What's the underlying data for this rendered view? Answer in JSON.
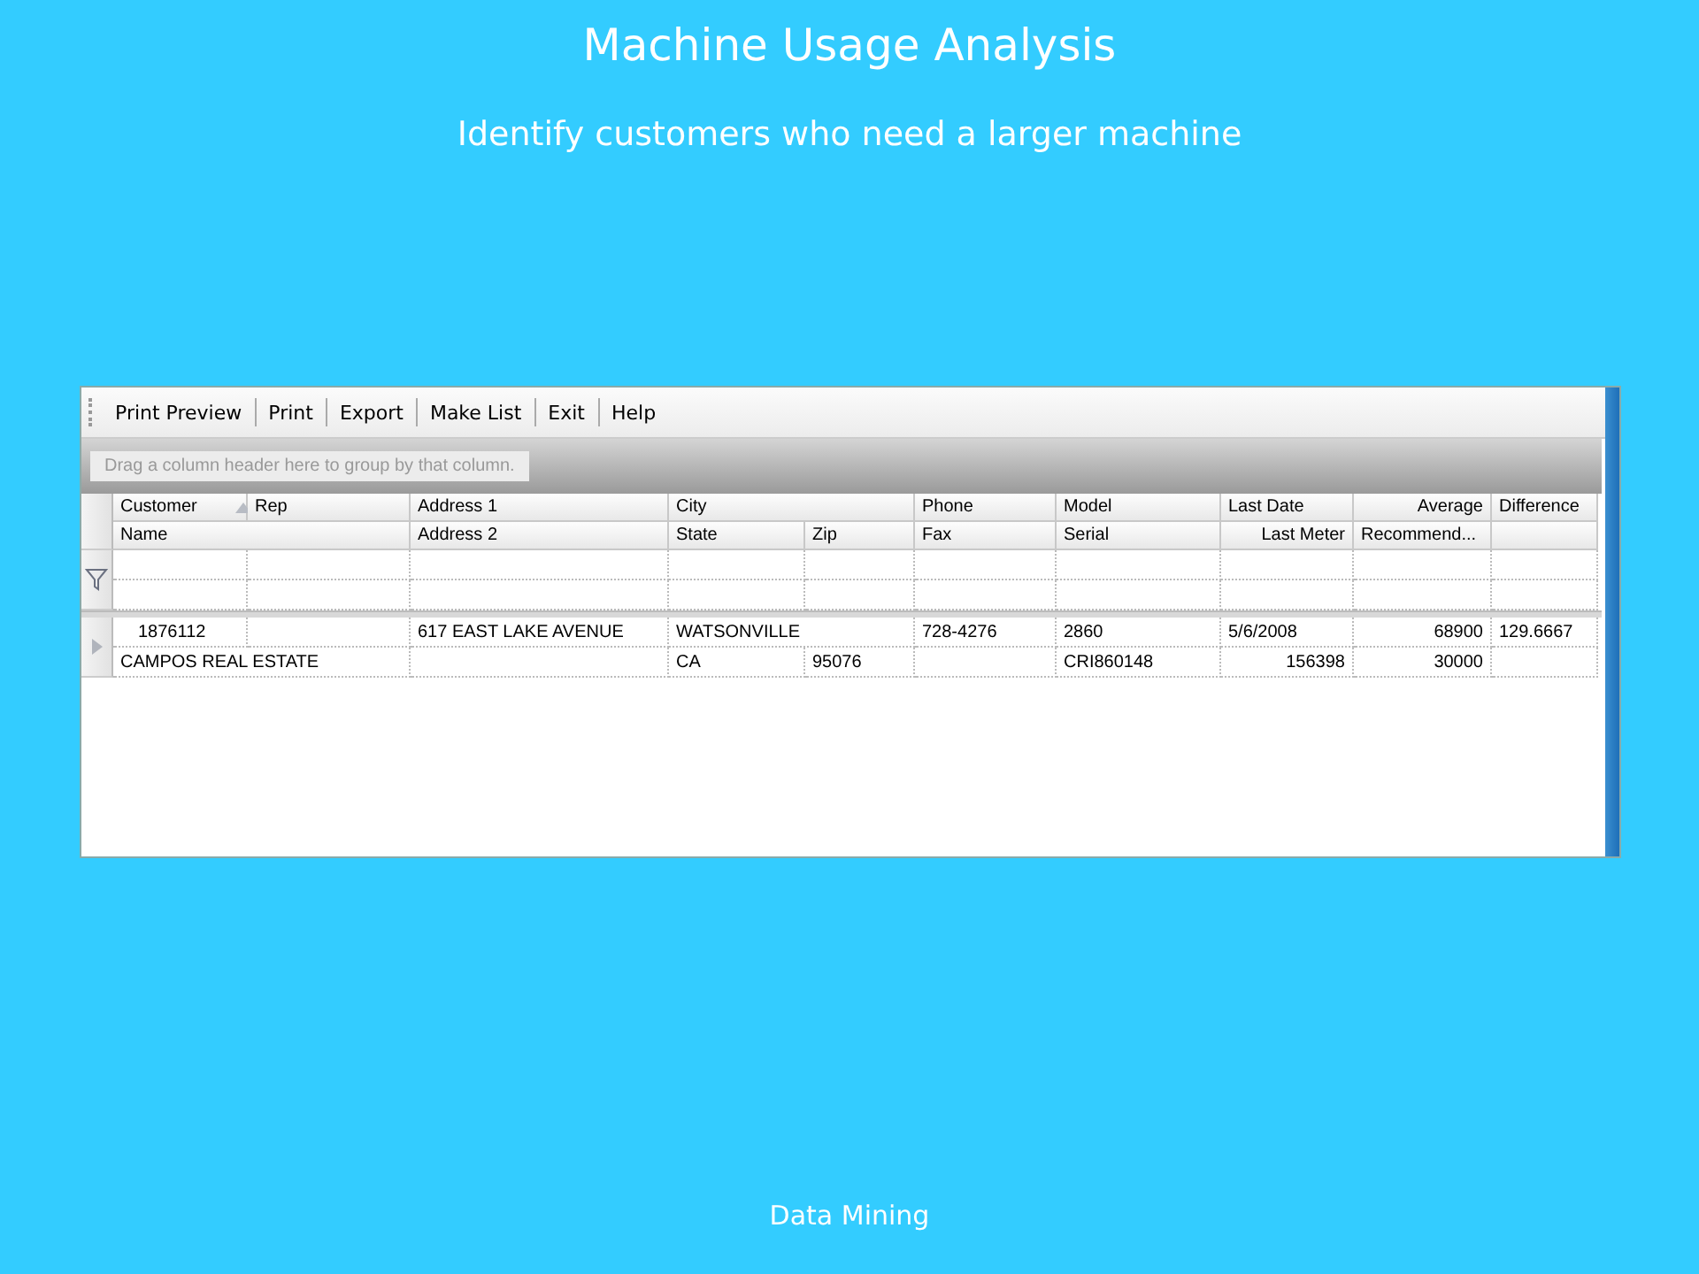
{
  "title": "Machine Usage Analysis",
  "subtitle": "Identify customers who need a larger machine",
  "toolbar": [
    "Print Preview",
    "Print",
    "Export",
    "Make List",
    "Exit",
    "Help"
  ],
  "group_panel": {
    "placeholder": "Drag a column header here to group by that column."
  },
  "header": [
    [
      {
        "text": "Customer",
        "sort_ascending": true
      },
      {
        "text": "Rep"
      },
      {
        "text": "Address 1"
      },
      {
        "text": "City",
        "kind": "wide"
      },
      {
        "text": "Phone"
      },
      {
        "text": "Model"
      },
      {
        "text": "Last Date"
      },
      {
        "text": "Average",
        "kind": "numeric"
      },
      {
        "text": "Difference"
      }
    ],
    [
      {
        "text": "Name",
        "kind": "wide"
      },
      {
        "text": "Address 2"
      },
      {
        "text": "State"
      },
      {
        "text": "Zip"
      },
      {
        "text": "Fax"
      },
      {
        "text": "Serial"
      },
      {
        "text": "Last Meter",
        "kind": "numeric"
      },
      {
        "text": "Recommend..."
      },
      {
        "kind": "blank"
      }
    ]
  ],
  "records": [
    {
      "current": true,
      "lines": [
        [
          {
            "text": "1876112",
            "kind": "indented"
          },
          {
            "kind": "blank"
          },
          {
            "text": "617 EAST LAKE AVENUE"
          },
          {
            "text": "WATSONVILLE",
            "kind": "wide"
          },
          {
            "text": "728-4276"
          },
          {
            "text": "2860"
          },
          {
            "text": "5/6/2008"
          },
          {
            "text": "68900",
            "kind": "numeric"
          },
          {
            "text": "129.6667"
          }
        ],
        [
          {
            "text": "CAMPOS REAL ESTATE",
            "kind": "wide"
          },
          {
            "kind": "blank"
          },
          {
            "text": "CA"
          },
          {
            "text": "95076"
          },
          {
            "kind": "blank"
          },
          {
            "text": "CRI860148"
          },
          {
            "text": "156398",
            "kind": "numeric"
          },
          {
            "text": "30000",
            "kind": "numeric"
          },
          {
            "kind": "blank"
          }
        ]
      ]
    }
  ],
  "footer": "Data Mining"
}
